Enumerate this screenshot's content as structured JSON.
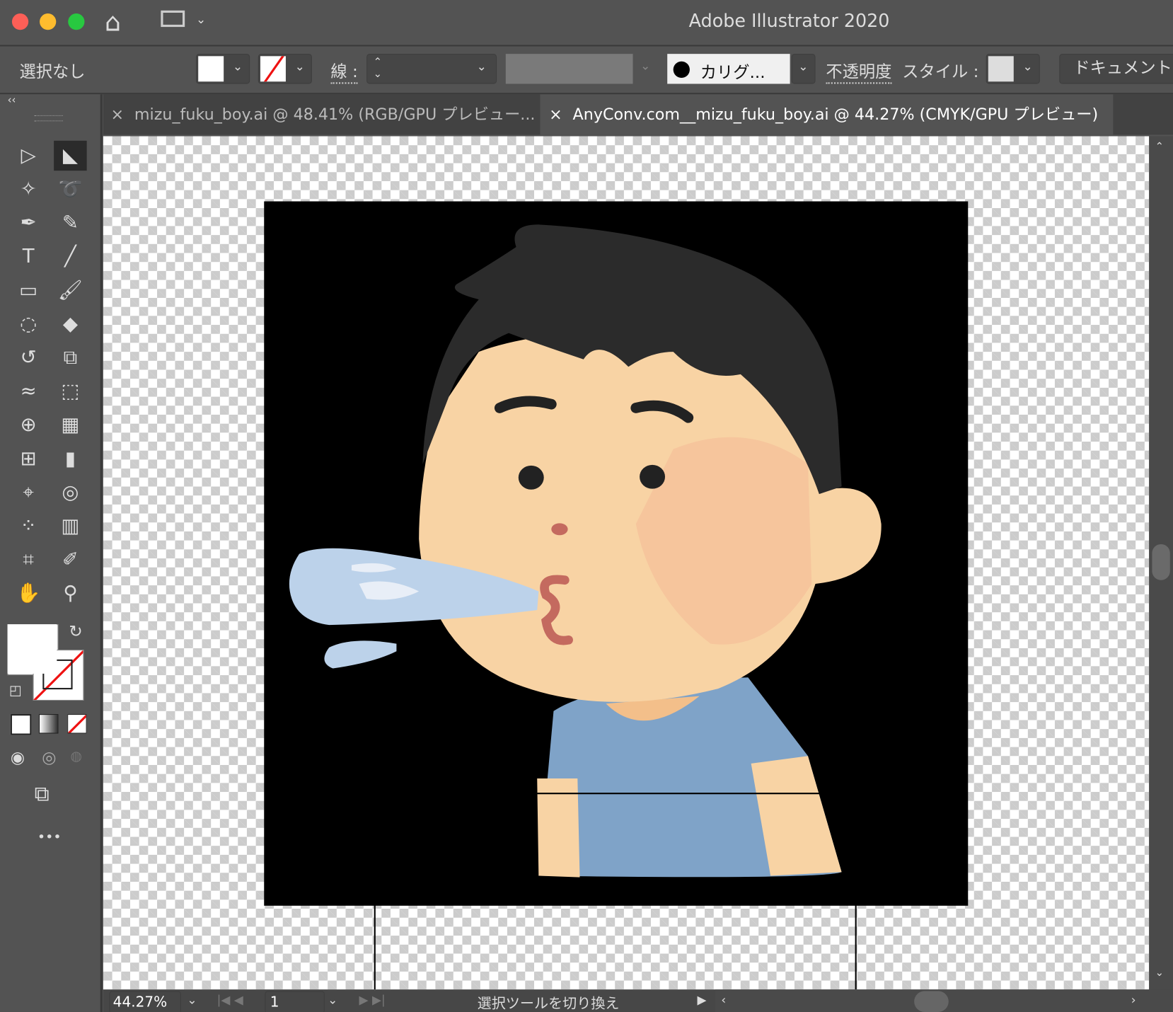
{
  "app_title": "Adobe Illustrator 2020",
  "control_bar": {
    "selection": "選択なし",
    "stroke_label": "線 :",
    "brush": "カリグ...",
    "opacity": "不透明度",
    "style": "スタイル :",
    "document": "ドキュメント"
  },
  "tabs": [
    {
      "label": "mizu_fuku_boy.ai @ 48.41% (RGB/GPU プレビュー...",
      "close": "×",
      "active": false
    },
    {
      "label": "AnyConv.com__mizu_fuku_boy.ai @ 44.27% (CMYK/GPU プレビュー)",
      "close": "×",
      "active": true
    }
  ],
  "toolbar": {
    "collapse": "‹‹",
    "more": "•••"
  },
  "status": {
    "zoom": "44.27%",
    "artboard": "1",
    "tool_hint": "選択ツールを切り換え"
  },
  "colors": {
    "skin": "#f8d3a4",
    "cheek": "#f6c59c",
    "hair": "#2b2b2b",
    "shirt": "#7fa3c8",
    "water": "#bcd2ea",
    "lips": "#c46a5f"
  }
}
